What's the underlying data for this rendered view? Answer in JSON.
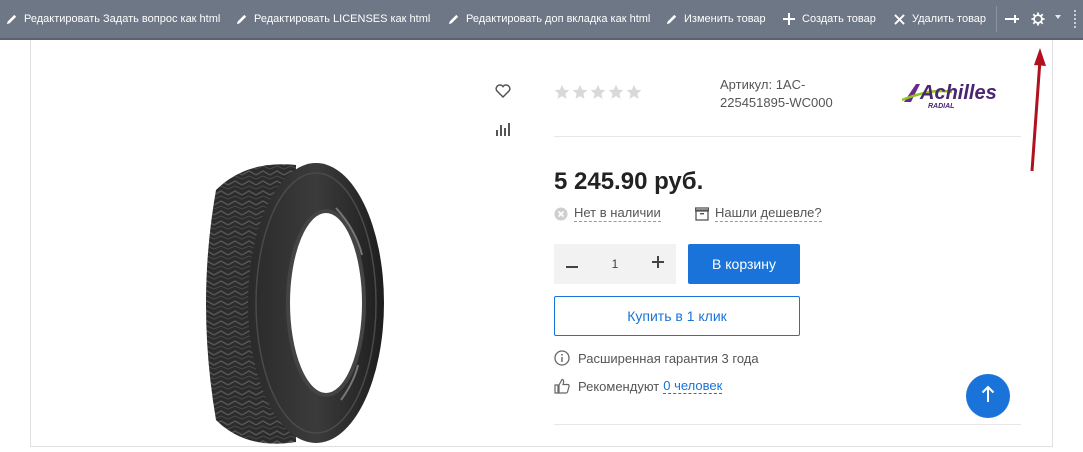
{
  "toolbar": {
    "items": [
      {
        "label": "Редактировать Задать вопрос как html",
        "icon": "pencil-icon"
      },
      {
        "label": "Редактировать LICENSES как html",
        "icon": "pencil-icon"
      },
      {
        "label": "Редактировать доп вкладка как html",
        "icon": "pencil-icon"
      },
      {
        "label": "Изменить товар",
        "icon": "pencil-icon"
      },
      {
        "label": "Создать товар",
        "icon": "plus-icon"
      },
      {
        "label": "Удалить товар",
        "icon": "close-icon"
      }
    ],
    "right_icons": [
      "pin-icon",
      "gear-icon",
      "chevron-down-icon",
      "drag-handle-icon"
    ],
    "bg_color": "#6e7785"
  },
  "product": {
    "rating": 0,
    "rating_max": 5,
    "article": "Артикул: 1AC-225451895-WC000",
    "brand": {
      "name": "Achilles",
      "sub": "RADIAL"
    },
    "price": "5 245.90 руб.",
    "availability": "Нет в наличии",
    "cheaper": "Нашли дешевле?",
    "quantity": "1",
    "cart_label": "В корзину",
    "oneclick_label": "Купить в 1 клик",
    "warranty": "Расширенная гарантия 3 года",
    "recommend_prefix": "Рекомендуют",
    "recommend_link": "0 человек"
  },
  "colors": {
    "accent": "#1a73d9",
    "annotation_arrow": "#b01020"
  }
}
